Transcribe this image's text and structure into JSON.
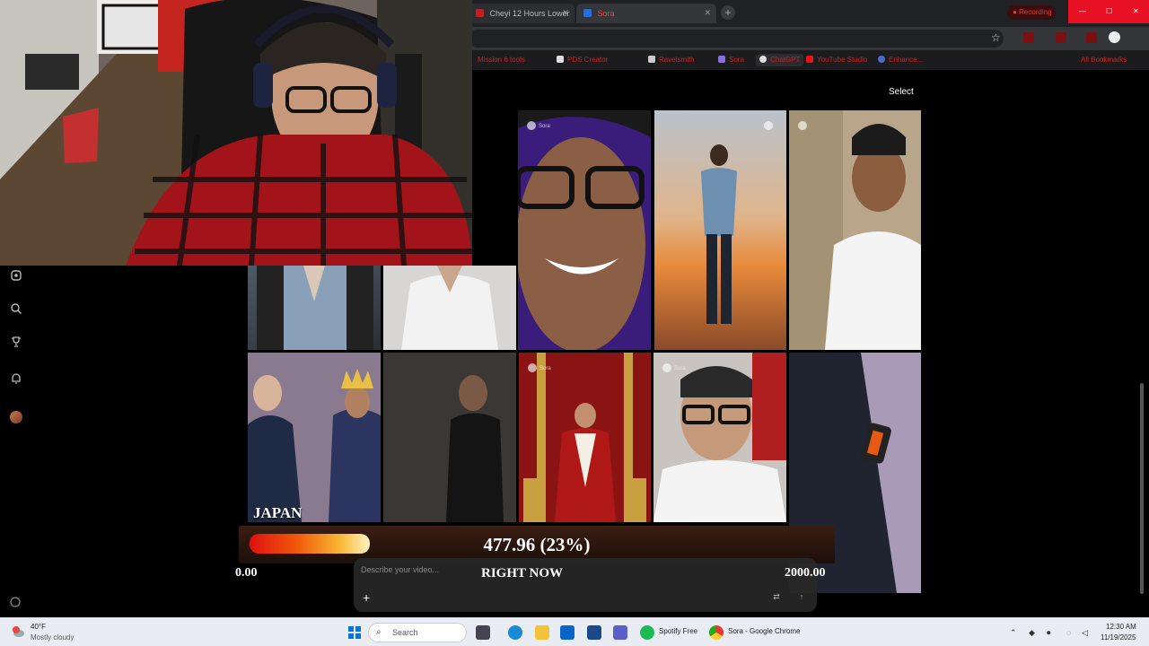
{
  "browser": {
    "tabs": [
      {
        "label": "Cheyi 12 Hours Lower",
        "active": false
      },
      {
        "label": "Sora",
        "active": true
      }
    ],
    "recording_label": "Recording",
    "bookmarks": [
      "Mission 6 tools",
      "PDS Creator",
      "Ravelsmith",
      "Sora",
      "ChatGPT",
      "YouTube Studio",
      "Enhance...",
      "All Bookmarks"
    ]
  },
  "page": {
    "select_label": "Select",
    "overlay": {
      "region": "JAPAN",
      "value_text": "477.96 (23%)",
      "progress_fraction": 0.23,
      "min_label": "0.00",
      "max_label": "2000.00",
      "period_label": "RIGHT NOW"
    },
    "composer": {
      "placeholder": "Describe your video...",
      "add_label": "+"
    },
    "tile_badge": "Sora"
  },
  "left_nav": [
    "home-icon",
    "search-icon",
    "trophy-icon",
    "bell-icon",
    "avatar"
  ],
  "taskbar": {
    "weather_temp": "40°F",
    "weather_desc": "Mostly cloudy",
    "search_label": "Search",
    "apps": [
      {
        "name": "spotify",
        "label": "Spotify Free"
      },
      {
        "name": "chrome",
        "label": "Sora - Google Chrome"
      }
    ],
    "time": "12:30 AM",
    "date": "11/19/2025"
  },
  "colors": {
    "accent": "#e01010",
    "meter_start": "#e01010",
    "meter_end": "#fff3c4"
  }
}
